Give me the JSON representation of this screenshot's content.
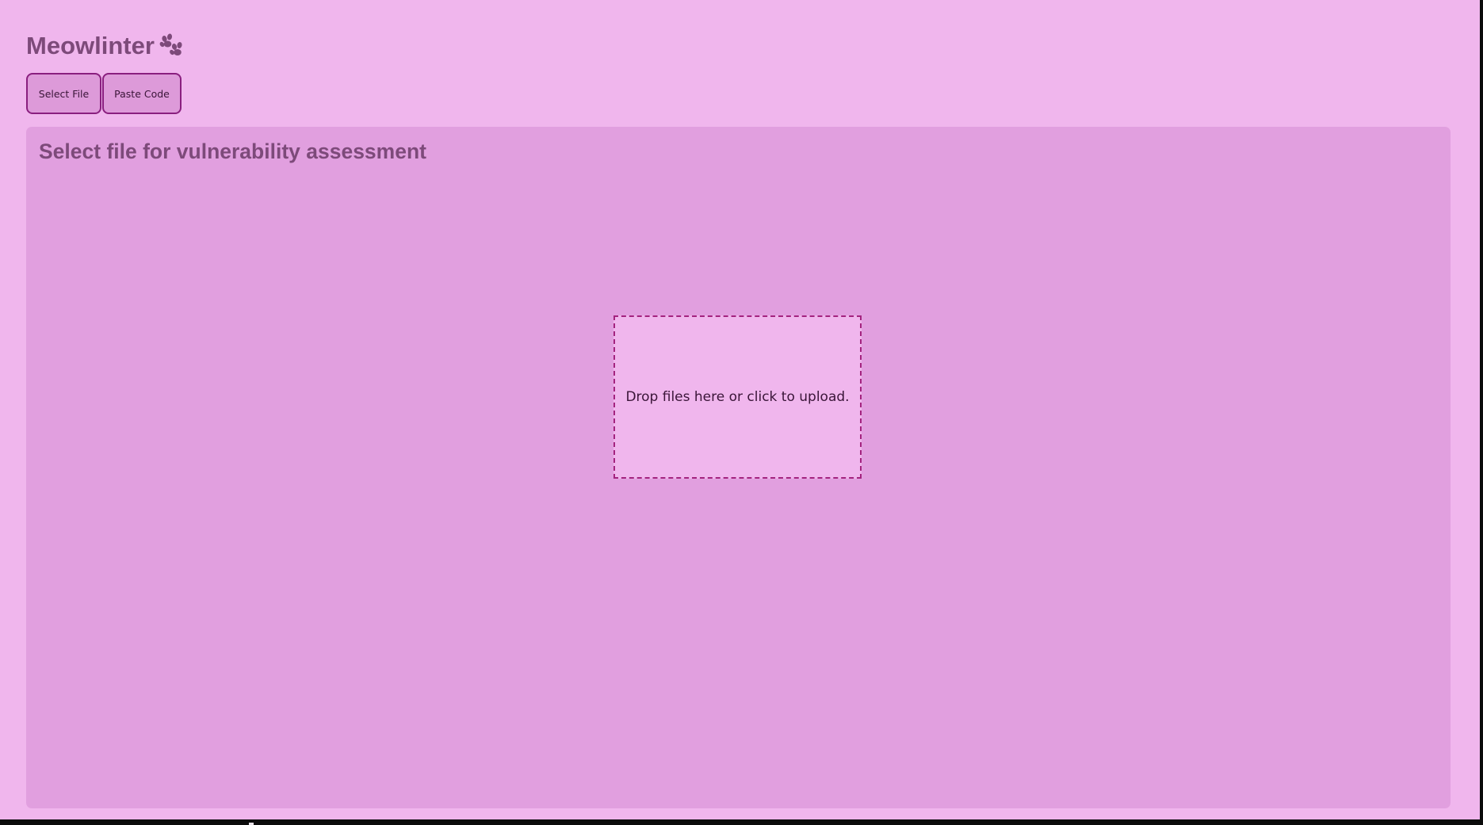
{
  "app": {
    "title": "Meowlinter",
    "title_icon": "paw-icon"
  },
  "tabs": [
    {
      "label": "Select File"
    },
    {
      "label": "Paste Code"
    }
  ],
  "panel": {
    "title": "Select file for vulnerability assessment"
  },
  "dropzone": {
    "text": "Drop files here or click to upload."
  },
  "colors": {
    "page_background": "#f0b6ed",
    "panel_background": "#e19fdf",
    "button_background": "#dd9ad9",
    "button_border": "#8a1e7f",
    "dropzone_border": "#a4237f",
    "heading_text": "#7d4a7a",
    "body_text": "#3a1538"
  }
}
